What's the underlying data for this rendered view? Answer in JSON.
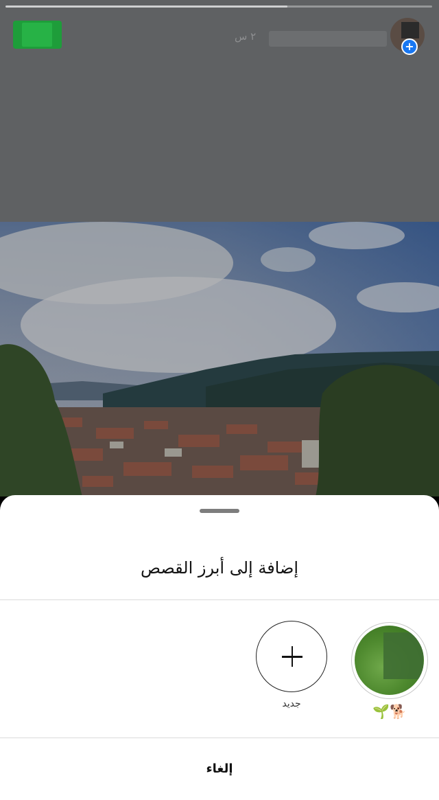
{
  "story": {
    "time_label": "٢ س",
    "progress_fraction": 0.66
  },
  "sheet": {
    "title": "إضافة إلى أبرز القصص",
    "highlights": [
      {
        "label": "🌱🐕",
        "kind": "existing"
      }
    ],
    "new_button": {
      "label": "جديد",
      "icon": "plus-icon"
    },
    "cancel_label": "إلغاء"
  },
  "colors": {
    "avatar_plus_badge": "#1877f2",
    "green_badge": "#1e9d3a",
    "divider": "#dbdbdb"
  }
}
